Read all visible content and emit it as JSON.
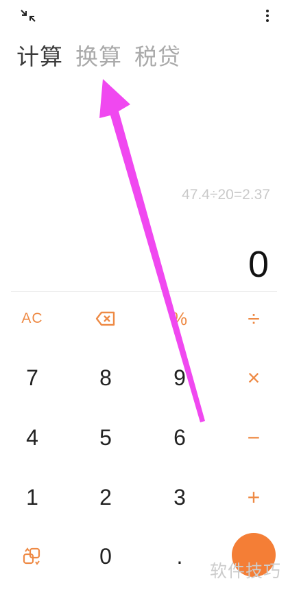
{
  "tabs": [
    "计算",
    "换算",
    "税贷"
  ],
  "history_text": "47.4÷20=2.37",
  "result_text": "0",
  "keys": {
    "ac": "AC",
    "percent": "%",
    "divide": "÷",
    "multiply": "×",
    "minus": "−",
    "plus": "+",
    "seven": "7",
    "eight": "8",
    "nine": "9",
    "four": "4",
    "five": "5",
    "six": "6",
    "one": "1",
    "two": "2",
    "three": "3",
    "zero": "0",
    "dot": "."
  },
  "watermark": "软件技巧",
  "colors": {
    "accent": "#ee8a45",
    "equals_bg": "#f47e36",
    "arrow": "#f048f0",
    "digit": "#222222"
  },
  "icons": {
    "collapse": "collapse-arrows-icon",
    "menu": "more-vertical-icon",
    "backspace": "backspace-icon",
    "mode": "mode-switch-icon"
  }
}
